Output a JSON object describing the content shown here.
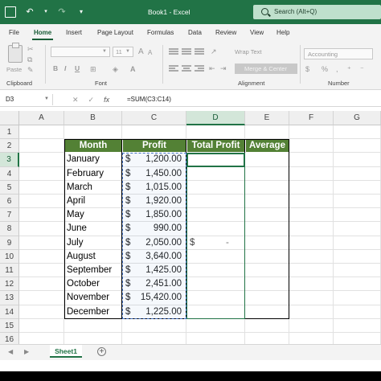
{
  "window": {
    "doc_title": "Book1 - Excel"
  },
  "search": {
    "placeholder": "Search (Alt+Q)"
  },
  "tabs": [
    "File",
    "Home",
    "Insert",
    "Page Layout",
    "Formulas",
    "Data",
    "Review",
    "View",
    "Help"
  ],
  "active_tab": "Home",
  "ribbon": {
    "clipboard_label": "Clipboard",
    "paste_label": "Paste",
    "font_label": "Font",
    "font_size": "11",
    "bold": "B",
    "italic": "I",
    "underline": "U",
    "alignment_label": "Alignment",
    "wrap_text": "Wrap Text",
    "merge_center": "Merge & Center",
    "number_label": "Number",
    "number_format": "Accounting"
  },
  "formula_bar": {
    "name_box": "D3",
    "fx": "fx",
    "formula": "=SUM(C3:C14)"
  },
  "columns": [
    "A",
    "B",
    "C",
    "D",
    "E",
    "F",
    "G"
  ],
  "rows": [
    "1",
    "2",
    "3",
    "4",
    "5",
    "6",
    "7",
    "8",
    "9",
    "10",
    "11",
    "12",
    "13",
    "14",
    "15",
    "16"
  ],
  "selected_cell": "D3",
  "table": {
    "headers": [
      "Month",
      "Profit",
      "Total Profit",
      "Average"
    ],
    "currency_symbol": "$",
    "rows": [
      {
        "month": "January",
        "profit": "1,200.00"
      },
      {
        "month": "February",
        "profit": "1,450.00"
      },
      {
        "month": "March",
        "profit": "1,015.00"
      },
      {
        "month": "April",
        "profit": "1,920.00"
      },
      {
        "month": "May",
        "profit": "1,850.00"
      },
      {
        "month": "June",
        "profit": "990.00"
      },
      {
        "month": "July",
        "profit": "2,050.00"
      },
      {
        "month": "August",
        "profit": "3,640.00"
      },
      {
        "month": "September",
        "profit": "1,425.00"
      },
      {
        "month": "October",
        "profit": "2,451.00"
      },
      {
        "month": "November",
        "profit": "15,420.00"
      },
      {
        "month": "December",
        "profit": "1,225.00"
      }
    ],
    "total_profit_display": "$",
    "total_profit_dash": "-"
  },
  "sheets": [
    "Sheet1"
  ],
  "colors": {
    "excel_green": "#217346",
    "header_green": "#538135"
  }
}
